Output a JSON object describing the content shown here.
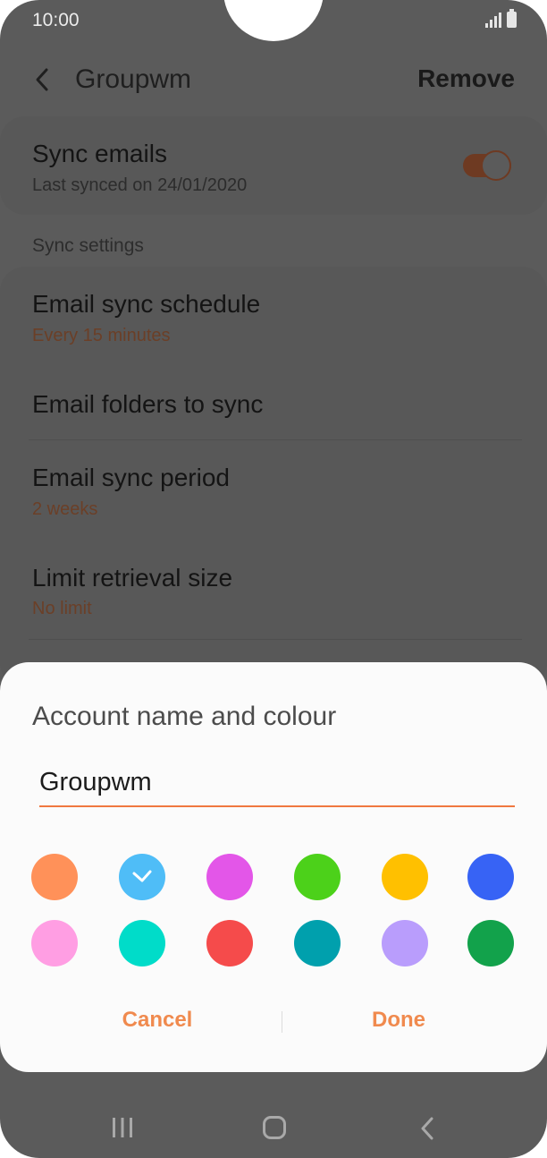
{
  "status_bar": {
    "time": "10:00"
  },
  "app_bar": {
    "title": "Groupwm",
    "remove_label": "Remove"
  },
  "sync_card": {
    "title": "Sync emails",
    "subtitle": "Last synced on 24/01/2020",
    "toggle_on": true
  },
  "section_header": "Sync settings",
  "settings": [
    {
      "title": "Email sync schedule",
      "value": "Every 15 minutes"
    },
    {
      "title": "Email folders to sync",
      "value": ""
    },
    {
      "title": "Email sync period",
      "value": "2 weeks"
    },
    {
      "title": "Limit retrieval size",
      "value": "No limit"
    }
  ],
  "dialog": {
    "title": "Account name and colour",
    "name_value": "Groupwm",
    "colors": [
      "#ff9159",
      "#4fbdf7",
      "#e356e8",
      "#4cd11a",
      "#ffc000",
      "#3763f5",
      "#ff9ee3",
      "#00dcc9",
      "#f54b4b",
      "#00a0ad",
      "#b99dfc",
      "#12a24b"
    ],
    "selected_color_index": 1,
    "cancel_label": "Cancel",
    "done_label": "Done"
  },
  "colors": {
    "accent": "#f07840",
    "dialog_bg": "#fbfbfb",
    "scrim": "#5b5b5b"
  }
}
